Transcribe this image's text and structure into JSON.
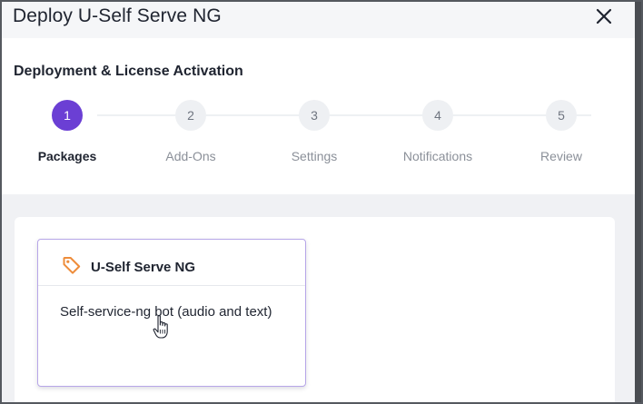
{
  "dialog": {
    "title": "Deploy U-Self Serve NG",
    "close_icon": "close-icon"
  },
  "section": {
    "title": "Deployment & License Activation"
  },
  "steps": [
    {
      "number": "1",
      "label": "Packages",
      "active": true
    },
    {
      "number": "2",
      "label": "Add-Ons",
      "active": false
    },
    {
      "number": "3",
      "label": "Settings",
      "active": false
    },
    {
      "number": "4",
      "label": "Notifications",
      "active": false
    },
    {
      "number": "5",
      "label": "Review",
      "active": false
    }
  ],
  "package_card": {
    "icon": "tag-icon",
    "title": "U-Self Serve NG",
    "description": "Self-service-ng bot (audio and text)"
  },
  "colors": {
    "accent": "#6b3fd4",
    "tag_icon": "#ee8c3a",
    "card_border": "#b7a6e8"
  }
}
